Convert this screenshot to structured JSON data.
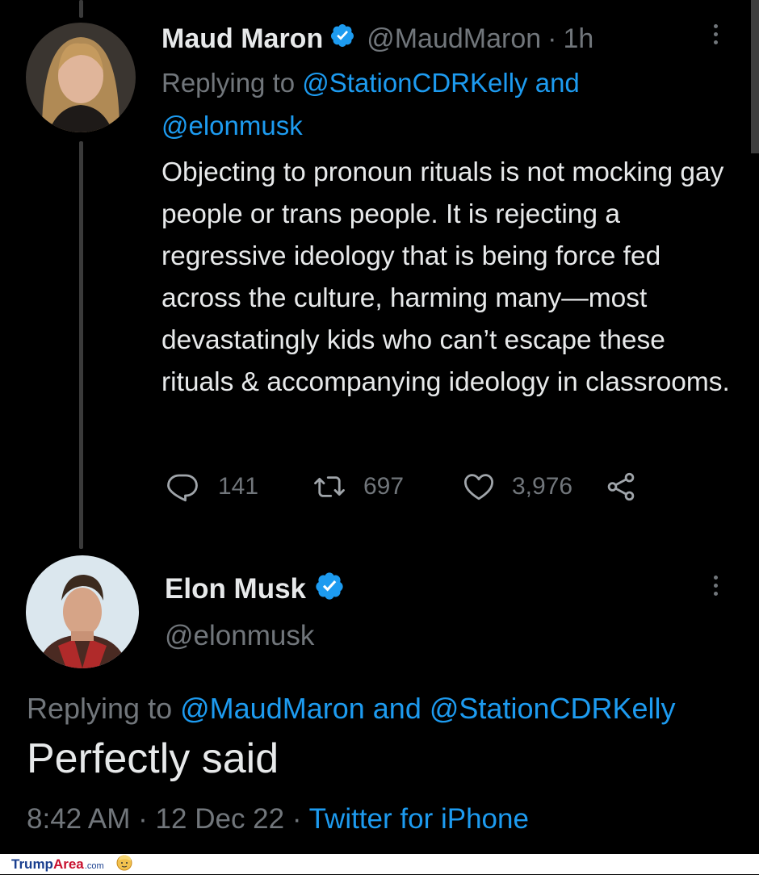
{
  "tweet1": {
    "author_name": "Maud Maron",
    "handle": "@MaudMaron",
    "separator": "·",
    "time": "1h",
    "replying_prefix": "Replying to",
    "replying_user1": "@StationCDRKelly",
    "replying_and": "and",
    "replying_user2": "@elonmusk",
    "text": "Objecting to pronoun rituals is not mocking gay people or trans people. It is rejecting a regressive ideology that is being force fed across the culture, harming many—most devastatingly kids who can’t escape these rituals & accompanying ideology in classrooms.",
    "replies": "141",
    "retweets": "697",
    "likes": "3,976"
  },
  "tweet2": {
    "author_name": "Elon Musk",
    "handle": "@elonmusk",
    "replying_prefix": "Replying to",
    "replying_user1": "@MaudMaron",
    "replying_and": "and",
    "replying_user2": "@StationCDRKelly",
    "text": "Perfectly said",
    "time": "8:42 AM",
    "sep": "·",
    "date": "12 Dec 22",
    "source": "Twitter for iPhone"
  },
  "watermark": {
    "part1": "Trump",
    "part2": "Area",
    "part3": ".com"
  },
  "icons": {
    "verified": "verified-badge-icon",
    "reply": "reply-icon",
    "retweet": "retweet-icon",
    "like": "heart-icon",
    "share": "share-icon",
    "more": "more-options-icon"
  },
  "colors": {
    "background": "#000000",
    "text": "#e7e9ea",
    "muted": "#71767b",
    "link": "#1d9bf0",
    "verified": "#1d9bf0"
  }
}
